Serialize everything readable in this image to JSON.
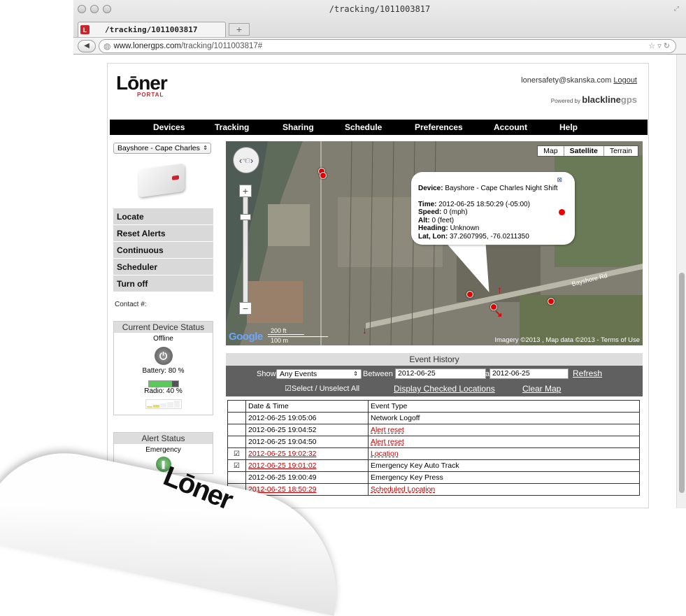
{
  "browser": {
    "window_title": "/tracking/1011003817",
    "tab_title": "/tracking/1011003817",
    "favicon_letter": "L",
    "new_tab_label": "+",
    "url_domain": "www.lonergps.com",
    "url_path": "/tracking/1011003817#"
  },
  "header": {
    "logo_main": "Lōner",
    "logo_sub": "PORTAL",
    "user_email": "lonersafety@skanska.com",
    "logout_label": "Logout",
    "powered_by": "Powered by",
    "powered_brand_a": "blackline",
    "powered_brand_b": "gps"
  },
  "nav": [
    "Devices",
    "Tracking",
    "Sharing",
    "Schedule",
    "Preferences",
    "Account",
    "Help"
  ],
  "sidebar": {
    "device_select": "Bayshore - Cape Charles",
    "actions": [
      "Locate",
      "Reset Alerts",
      "Continuous",
      "Scheduler",
      "Turn off"
    ],
    "contact_label": "Contact #:",
    "status": {
      "title": "Current Device Status",
      "state": "Offline",
      "battery_label": "Battery: 80 %",
      "battery_level": 0.8,
      "radio_label": "Radio: 40 %",
      "radio_level": 0.4
    },
    "alert": {
      "title": "Alert Status",
      "state": "Emergency"
    }
  },
  "map": {
    "types": [
      "Map",
      "Satellite",
      "Terrain"
    ],
    "active_type": "Satellite",
    "popup": {
      "device_label": "Device:",
      "device_value": "Bayshore - Cape Charles Night Shift",
      "time_label": "Time:",
      "time_value": "2012-06-25 18:50:29 (-05:00)",
      "speed_label": "Speed:",
      "speed_value": "0 (mph)",
      "alt_label": "Alt:",
      "alt_value": "0 (feet)",
      "heading_label": "Heading:",
      "heading_value": "Unknown",
      "latlon_label": "Lat, Lon:",
      "latlon_value": "37.2607995, -76.0211350"
    },
    "scale_ft": "200 ft",
    "scale_m": "100 m",
    "road_label": "Bayshore Rd",
    "google": "Google",
    "credit": "Imagery ©2013 , Map data ©2013 -",
    "terms": "Terms of Use"
  },
  "events": {
    "title": "Event History",
    "show_label": "Show:",
    "filter_value": "Any Events",
    "between_label": "Between",
    "date_from": "2012-06-25",
    "and_label": "and",
    "date_to": "2012-06-25",
    "refresh_label": "Refresh",
    "select_all_label": "Select / Unselect All",
    "display_checked_label": "Display Checked Locations",
    "clear_map_label": "Clear Map",
    "columns": [
      "Date & Time",
      "Event Type"
    ],
    "rows": [
      {
        "checked": false,
        "time": "2012-06-25 19:05:06",
        "type": "Network Logoff",
        "style": ""
      },
      {
        "checked": false,
        "time": "2012-06-25 19:04:52",
        "type": "Alert reset",
        "style": "alert"
      },
      {
        "checked": false,
        "time": "2012-06-25 19:04:50",
        "type": "Alert reset",
        "style": "alert"
      },
      {
        "checked": true,
        "time": "2012-06-25 19:02:32",
        "type": "Location",
        "style": "loc"
      },
      {
        "checked": true,
        "time": "2012-06-25 19:01:02",
        "type": "Emergency Key Auto Track",
        "style": "loctime"
      },
      {
        "checked": false,
        "time": "2012-06-25 19:00:49",
        "type": "Emergency Key Press",
        "style": ""
      },
      {
        "checked": false,
        "time": "2012-06-25 18:50:29",
        "type": "Scheduled Location",
        "style": "loc"
      }
    ]
  },
  "device_photo_text": "Lōner"
}
